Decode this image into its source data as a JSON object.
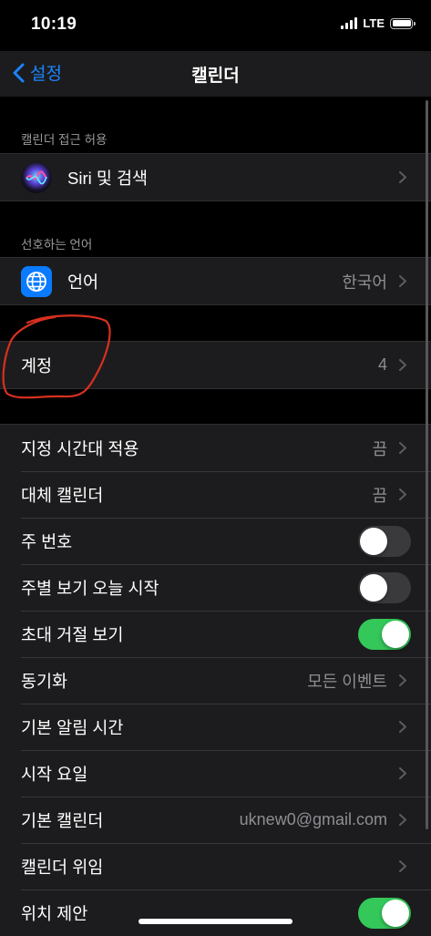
{
  "status_bar": {
    "time": "10:19",
    "network": "LTE",
    "battery_percent": 100
  },
  "nav": {
    "back_label": "설정",
    "title": "캘린더"
  },
  "section1": {
    "header": "캘린더 접근 허용",
    "rows": [
      {
        "label": "Siri 및 검색",
        "icon": "siri-icon"
      }
    ]
  },
  "section2": {
    "header": "선호하는 언어",
    "rows": [
      {
        "label": "언어",
        "value": "한국어",
        "icon": "globe-icon"
      }
    ]
  },
  "section3": {
    "rows": [
      {
        "label": "계정",
        "value": "4"
      }
    ]
  },
  "section4": {
    "rows": [
      {
        "label": "지정 시간대 적용",
        "value": "끔"
      },
      {
        "label": "대체 캘린더",
        "value": "끔"
      },
      {
        "label": "주 번호",
        "toggle": false
      },
      {
        "label": "주별 보기 오늘 시작",
        "toggle": false
      },
      {
        "label": "초대 거절 보기",
        "toggle": true
      },
      {
        "label": "동기화",
        "value": "모든 이벤트"
      },
      {
        "label": "기본 알림 시간",
        "value": ""
      },
      {
        "label": "시작 요일",
        "value": ""
      },
      {
        "label": "기본 캘린더",
        "value": "uknew0@gmail.com"
      },
      {
        "label": "캘린더 위임",
        "value": ""
      },
      {
        "label": "위치 제안",
        "toggle": true
      }
    ]
  },
  "colors": {
    "accent": "#1a84ff",
    "toggle_on": "#34c759",
    "annotation": "#d83020"
  }
}
